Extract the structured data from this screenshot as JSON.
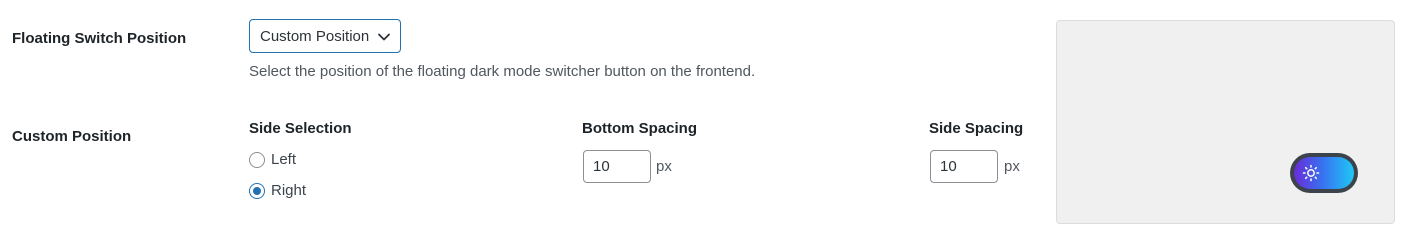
{
  "settings": {
    "floating_switch_position": {
      "label": "Floating Switch Position",
      "selected": "Custom Position",
      "description": "Select the position of the floating dark mode switcher button on the frontend."
    },
    "custom_position": {
      "label": "Custom Position",
      "side_selection": {
        "heading": "Side Selection",
        "options": [
          "Left",
          "Right"
        ],
        "selected": "Right"
      },
      "bottom_spacing": {
        "heading": "Bottom Spacing",
        "value": "10",
        "unit": "px"
      },
      "side_spacing": {
        "heading": "Side Spacing",
        "value": "10",
        "unit": "px"
      }
    }
  },
  "preview": {
    "toggle_icon": "sun-icon",
    "colors": {
      "toggle_frame": "#3c434a",
      "gradient_start": "#6a2bd8",
      "gradient_end": "#1ec8f5",
      "accent": "#2271b1"
    }
  }
}
